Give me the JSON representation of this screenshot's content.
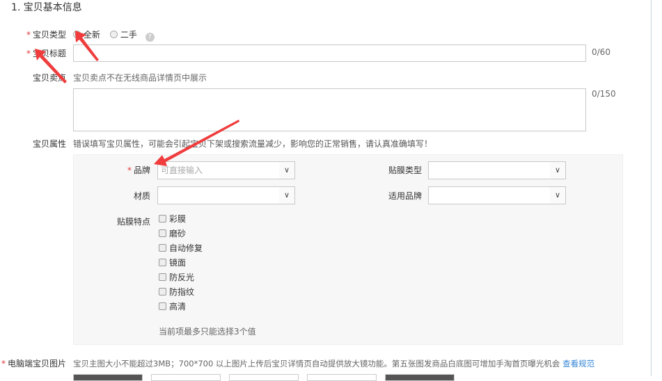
{
  "section_title": "1. 宝贝基本信息",
  "item_type": {
    "label": "宝贝类型",
    "options": [
      "全新",
      "二手"
    ],
    "selected": "全新",
    "help": "?"
  },
  "item_title": {
    "label": "宝贝标题",
    "value": "",
    "counter": "0/60"
  },
  "selling_point": {
    "label": "宝贝卖点",
    "hint": "宝贝卖点不在无线商品详情页中展示",
    "value": "",
    "counter": "0/150"
  },
  "attributes": {
    "label": "宝贝属性",
    "hint": "错误填写宝贝属性，可能会引起宝贝下架或搜索流量减少，影响您的正常销售，请认真准确填写！",
    "brand": {
      "label": "品牌",
      "placeholder": "可直接输入"
    },
    "film_type": {
      "label": "贴膜类型",
      "value": ""
    },
    "material": {
      "label": "材质",
      "value": ""
    },
    "applicable_brand": {
      "label": "适用品牌",
      "value": ""
    },
    "features": {
      "label": "贴膜特点",
      "options": [
        "彩膜",
        "磨砂",
        "自动修复",
        "镜面",
        "防反光",
        "防指纹",
        "高清"
      ],
      "note": "当前项最多只能选择3个值"
    }
  },
  "pc_images": {
    "label": "电脑端宝贝图片",
    "hint": "宝贝主图大小不能超过3MB；700*700 以上图片上传后宝贝详情页自动提供放大镜功能。第五张图发商品白底图可增加手淘首页曝光机会",
    "link": "查看规范"
  },
  "colors": {
    "required_star": "#e4393c",
    "link": "#3385d6",
    "arrow": "#f03c3c"
  }
}
